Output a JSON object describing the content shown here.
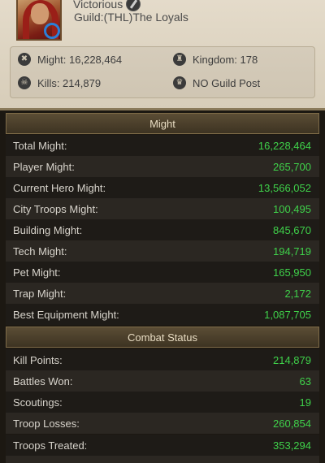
{
  "profile": {
    "status_text": "Victorious",
    "guild_text": "Guild:(THL)The Loyals",
    "might_label": "Might: 16,228,464",
    "kingdom_label": "Kingdom: 178",
    "kills_label": "Kills: 214,879",
    "guild_post_label": "NO Guild Post"
  },
  "sections": {
    "might_title": "Might",
    "combat_title": "Combat Status"
  },
  "might_rows": [
    {
      "label": "Total Might:",
      "value": "16,228,464"
    },
    {
      "label": "Player Might:",
      "value": "265,700"
    },
    {
      "label": "Current Hero Might:",
      "value": "13,566,052"
    },
    {
      "label": "City Troops Might:",
      "value": "100,495"
    },
    {
      "label": "Building Might:",
      "value": "845,670"
    },
    {
      "label": "Tech Might:",
      "value": "194,719"
    },
    {
      "label": "Pet Might:",
      "value": "165,950"
    },
    {
      "label": "Trap Might:",
      "value": "2,172"
    },
    {
      "label": "Best Equipment Might:",
      "value": "1,087,705"
    }
  ],
  "combat_rows": [
    {
      "label": "Kill Points:",
      "value": "214,879"
    },
    {
      "label": "Battles Won:",
      "value": "63"
    },
    {
      "label": "Scoutings:",
      "value": "19"
    },
    {
      "label": "Troop Losses:",
      "value": "260,854"
    },
    {
      "label": "Troops Treated:",
      "value": "353,294"
    }
  ],
  "colors": {
    "value_green": "#3fd14a",
    "header_gold": "#5b4d35",
    "panel_beige": "#e4dbca"
  }
}
